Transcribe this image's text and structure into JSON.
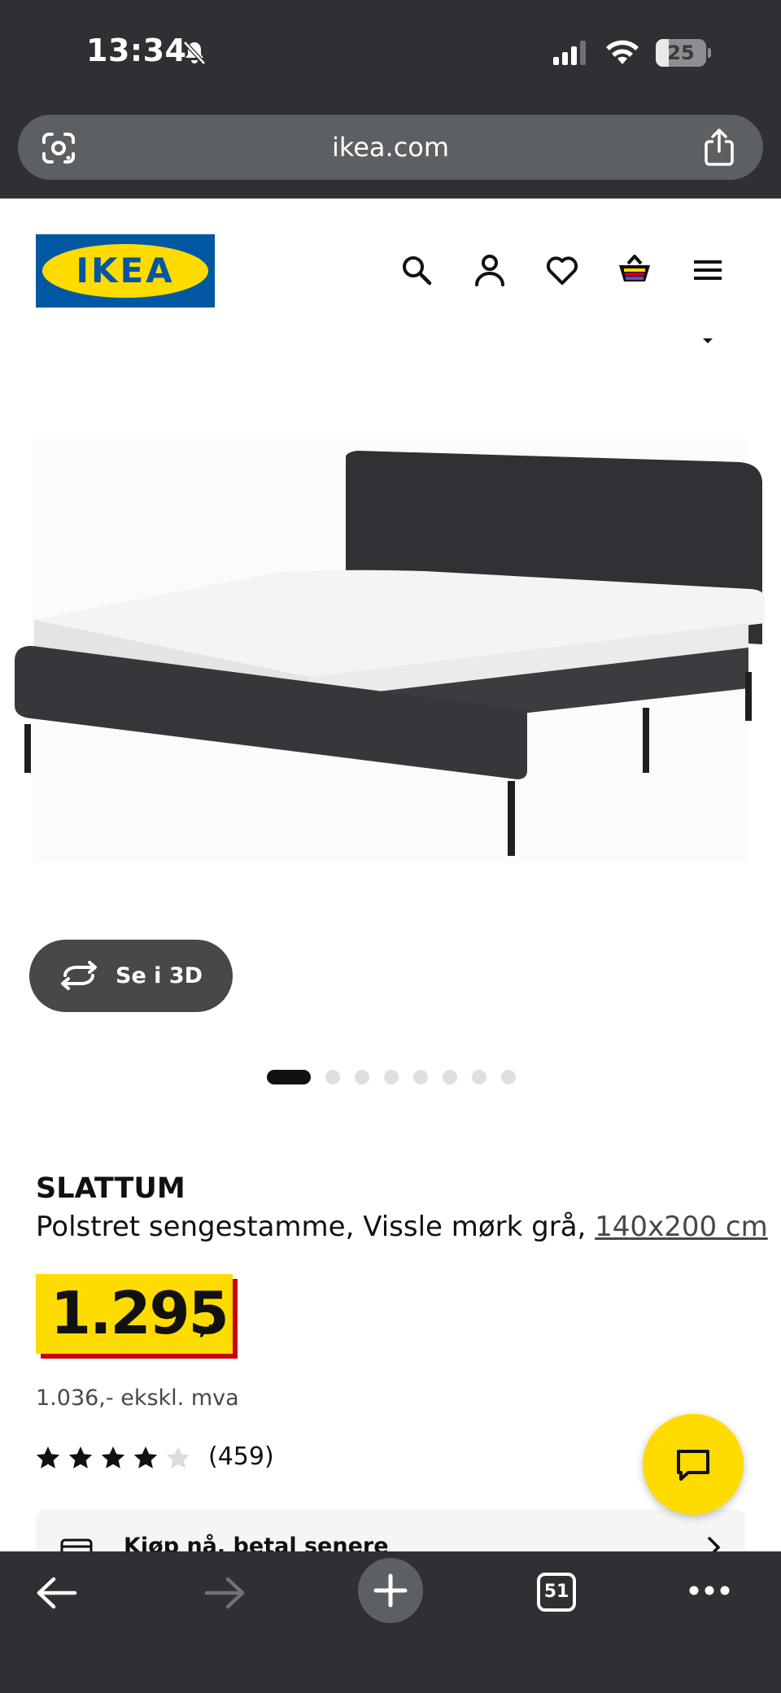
{
  "status_bar": {
    "time": "13:34",
    "battery": "25",
    "battery_level": 0.25
  },
  "browser": {
    "url": "ikea.com",
    "tab_count": "51"
  },
  "header": {
    "logo_text": "IKEA"
  },
  "product": {
    "name": "SLATTUM",
    "description": "Polstret sengestamme, Vissle mørk grå, ",
    "size": "140x200 cm",
    "price": "1.295",
    "price_suffix": ",-",
    "price_ex_vat": "1.036,- ekskl. mva",
    "rating_stars": 4,
    "rating_count": "(459)",
    "view_3d_label": "Se i 3D",
    "image_count": 8,
    "active_image": 1
  },
  "promo": {
    "label": "Kjøp nå, betal senere"
  },
  "colors": {
    "ikea_blue": "#0058a3",
    "ikea_yellow": "#ffdb00",
    "price_red": "#cc0008",
    "browser_dark": "#2e3033"
  }
}
